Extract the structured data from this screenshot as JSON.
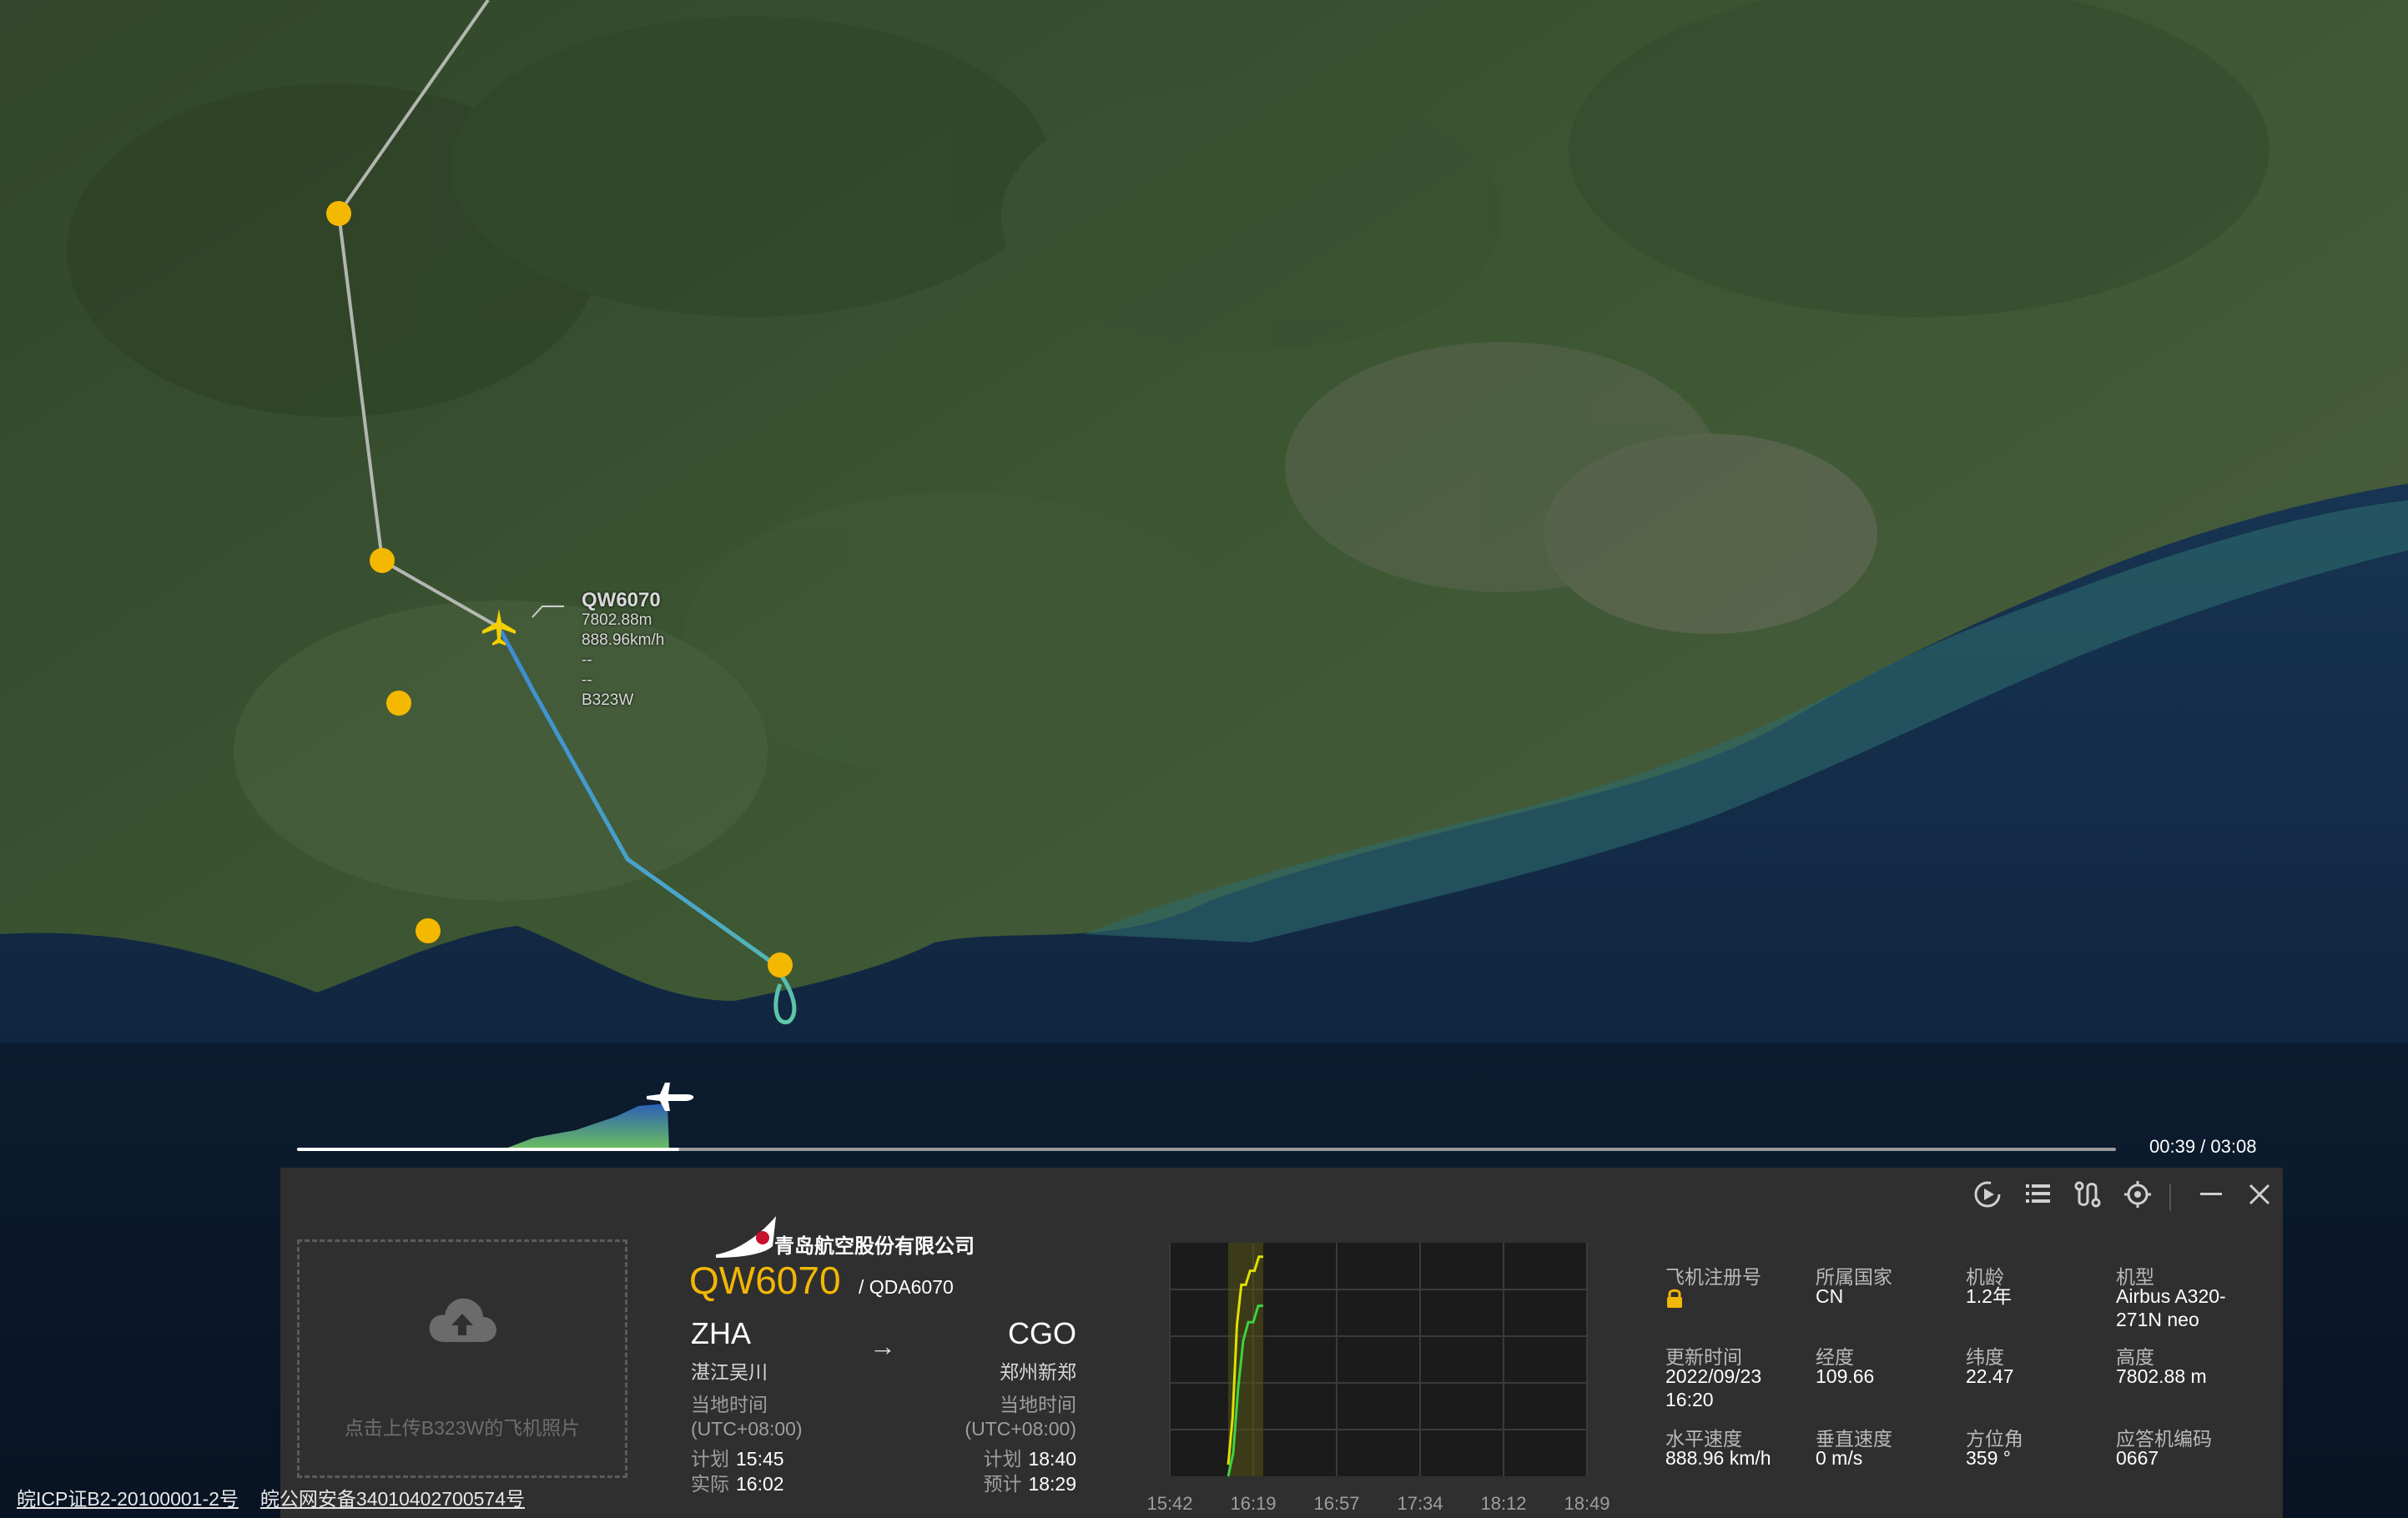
{
  "map": {
    "flight_label": {
      "callsign": "QW6070",
      "altitude": "7802.88m",
      "speed": "888.96km/h",
      "line3": "--",
      "line4": "--",
      "registration": "B323W"
    }
  },
  "playback": {
    "time": "00:39 / 03:08",
    "progress": 0.21
  },
  "panel": {
    "toolbar": {
      "replay_icon": "replay-icon",
      "list_icon": "list-icon",
      "route_icon": "route-icon",
      "locate_icon": "locate-icon",
      "minimize_icon": "minimize-icon",
      "close_icon": "close-icon"
    },
    "photo_upload_text": "点击上传B323W的飞机照片",
    "airline": "青岛航空股份有限公司",
    "flight_no": "QW6070",
    "flight_alt": "/ QDA6070",
    "origin": {
      "code": "ZHA",
      "city": "湛江吴川",
      "local_time_label": "当地时间",
      "utc": "(UTC+08:00)",
      "plan_label": "计划",
      "plan": "15:45",
      "actual_label": "实际",
      "actual": "16:02"
    },
    "route_arrow": "→",
    "destination": {
      "code": "CGO",
      "city": "郑州新郑",
      "local_time_label": "当地时间",
      "utc": "(UTC+08:00)",
      "plan_label": "计划",
      "plan": "18:40",
      "est_label": "预计",
      "est": "18:29"
    },
    "info": [
      {
        "label": "飞机注册号",
        "value": ""
      },
      {
        "label": "所属国家",
        "value": "CN"
      },
      {
        "label": "机龄",
        "value": "1.2年"
      },
      {
        "label": "机型",
        "value": "Airbus A320-271N neo"
      },
      {
        "label": "更新时间",
        "value": "2022/09/23 16:20"
      },
      {
        "label": "经度",
        "value": "109.66"
      },
      {
        "label": "纬度",
        "value": "22.47"
      },
      {
        "label": "高度",
        "value": "7802.88 m"
      },
      {
        "label": "水平速度",
        "value": "888.96 km/h"
      },
      {
        "label": "垂直速度",
        "value": "0 m/s"
      },
      {
        "label": "方位角",
        "value": "359 °"
      },
      {
        "label": "应答机编码",
        "value": "0667"
      }
    ]
  },
  "chart_data": {
    "type": "line",
    "x": [
      "15:42",
      "16:19",
      "16:57",
      "17:34",
      "18:12",
      "18:49"
    ],
    "series": [
      {
        "name": "",
        "color": "#e0e000",
        "values": [
          0.05,
          0.25,
          0.65,
          0.82,
          0.82,
          0.88,
          0.88,
          0.94,
          0.94
        ]
      },
      {
        "name": "",
        "color": "#3fd13f",
        "values": [
          0.0,
          0.1,
          0.38,
          0.58,
          0.66,
          0.66,
          0.73,
          0.73
        ]
      }
    ],
    "grid": true
  },
  "footer": {
    "icp": "皖ICP证B2-20100001-2号",
    "police": "皖公网安备34010402700574号"
  }
}
